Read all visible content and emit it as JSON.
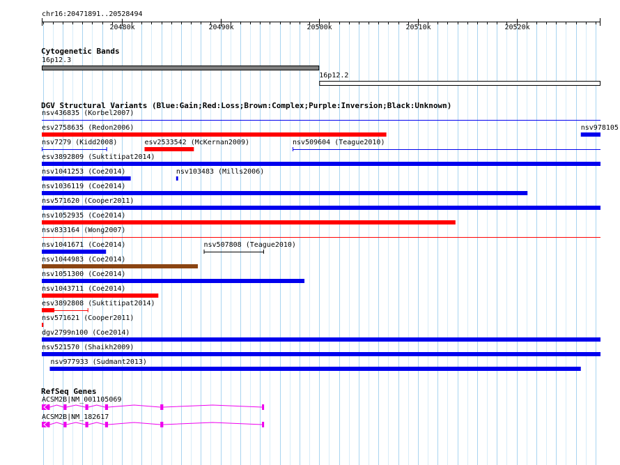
{
  "ruler": {
    "location": "chr16:20471891..20528494",
    "start": 20471891,
    "end": 20528494,
    "ticks": [
      {
        "pos": 20480000,
        "label": "20480k"
      },
      {
        "pos": 20490000,
        "label": "20490k"
      },
      {
        "pos": 20500000,
        "label": "20500k"
      },
      {
        "pos": 20510000,
        "label": "20510k"
      },
      {
        "pos": 20520000,
        "label": "20520k"
      }
    ]
  },
  "tracks": {
    "cytobands": {
      "title": "Cytogenetic Bands",
      "bands": [
        {
          "label": "16p12.3",
          "start": 20471891,
          "end": 20500000,
          "fill": "#808080"
        },
        {
          "label": "16p12.2",
          "start": 20500000,
          "end": 20528494,
          "fill": "#ffffff"
        }
      ]
    },
    "dgv": {
      "title": "DGV Structural Variants (Blue:Gain;Red:Loss;Brown:Complex;Purple:Inversion;Black:Unknown)",
      "colors": {
        "gain": "#0000ee",
        "loss": "#ff0000",
        "complex": "#8b4513",
        "unknown": "#000000"
      },
      "rows": [
        [
          {
            "label": "nsv436835 (Korbel2007)",
            "start": 20471891,
            "end": 20528494,
            "type": "gain",
            "style": "line"
          }
        ],
        [
          {
            "label": "esv2758635 (Redon2006)",
            "start": 20471891,
            "end": 20506800,
            "type": "loss",
            "style": "bar"
          },
          {
            "label": "nsv978105",
            "start": 20526500,
            "end": 20528494,
            "type": "gain",
            "style": "bar"
          }
        ],
        [
          {
            "label": "nsv7279 (Kidd2008)",
            "start": 20471891,
            "end": 20478500,
            "type": "gain",
            "style": "line"
          },
          {
            "label": "esv2533542 (McKernan2009)",
            "start": 20482300,
            "end": 20487300,
            "type": "loss",
            "style": "bar"
          },
          {
            "label": "nsv509604 (Teague2010)",
            "start": 20497300,
            "end": 20528494,
            "type": "gain",
            "style": "line"
          }
        ],
        [
          {
            "label": "esv3892809 (Suktitipat2014)",
            "start": 20471891,
            "end": 20528494,
            "type": "gain",
            "style": "bar"
          }
        ],
        [
          {
            "label": "nsv1041253 (Coe2014)",
            "start": 20471891,
            "end": 20480900,
            "type": "gain",
            "style": "bar"
          },
          {
            "label": "nsv103483 (Mills2006)",
            "start": 20485500,
            "end": 20485700,
            "type": "gain",
            "style": "bar"
          }
        ],
        [
          {
            "label": "nsv1036119 (Coe2014)",
            "start": 20471891,
            "end": 20521100,
            "type": "gain",
            "style": "bar"
          }
        ],
        [
          {
            "label": "nsv571620 (Cooper2011)",
            "start": 20471891,
            "end": 20528494,
            "type": "gain",
            "style": "bar"
          }
        ],
        [
          {
            "label": "nsv1052935 (Coe2014)",
            "start": 20471891,
            "end": 20513800,
            "type": "loss",
            "style": "bar"
          }
        ],
        [
          {
            "label": "nsv833164 (Wong2007)",
            "start": 20471891,
            "end": 20528494,
            "type": "loss",
            "style": "line"
          }
        ],
        [
          {
            "label": "nsv1041671 (Coe2014)",
            "start": 20471891,
            "end": 20478400,
            "type": "gain",
            "style": "bar"
          },
          {
            "label": "nsv507808 (Teague2010)",
            "start": 20488300,
            "end": 20494400,
            "type": "unknown",
            "style": "line"
          }
        ],
        [
          {
            "label": "nsv1044983 (Coe2014)",
            "start": 20471891,
            "end": 20487700,
            "type": "complex",
            "style": "bar"
          }
        ],
        [
          {
            "label": "nsv1051300 (Coe2014)",
            "start": 20471891,
            "end": 20498500,
            "type": "gain",
            "style": "bar"
          }
        ],
        [
          {
            "label": "nsv1043711 (Coe2014)",
            "start": 20471891,
            "end": 20483700,
            "type": "loss",
            "style": "bar"
          }
        ],
        [
          {
            "label": "esv3892808 (Suktitipat2014)",
            "start": 20471891,
            "end": 20476600,
            "type": "loss",
            "style": "split"
          }
        ],
        [
          {
            "label": "nsv571621 (Cooper2011)",
            "start": 20471891,
            "end": 20472050,
            "type": "loss",
            "style": "bar"
          }
        ],
        [
          {
            "label": "dgv2799n100 (Coe2014)",
            "start": 20471891,
            "end": 20528494,
            "type": "gain",
            "style": "bar"
          }
        ],
        [
          {
            "label": "nsv521570 (Shaikh2009)",
            "start": 20471891,
            "end": 20528494,
            "type": "gain",
            "style": "bar"
          }
        ],
        [
          {
            "label": "nsv977933 (Sudmant2013)",
            "start": 20472700,
            "end": 20526500,
            "type": "gain",
            "style": "bar"
          }
        ]
      ]
    },
    "refseq": {
      "title": "RefSeq Genes",
      "color": "#ee00ee",
      "genes": [
        {
          "label": "ACSM2B|NM_001105069",
          "start": 20471891,
          "end": 20494400,
          "exons": [
            [
              20471891,
              20472700
            ],
            [
              20474100,
              20474400
            ],
            [
              20476300,
              20476600
            ],
            [
              20478300,
              20478600
            ],
            [
              20483900,
              20484200
            ],
            [
              20494200,
              20494400
            ]
          ]
        },
        {
          "label": "ACSM2B|NM_182617",
          "start": 20471891,
          "end": 20494400,
          "exons": [
            [
              20471891,
              20472700
            ],
            [
              20474100,
              20474400
            ],
            [
              20476300,
              20476600
            ],
            [
              20478300,
              20478600
            ],
            [
              20483900,
              20484200
            ],
            [
              20494200,
              20494400
            ]
          ]
        }
      ]
    }
  }
}
